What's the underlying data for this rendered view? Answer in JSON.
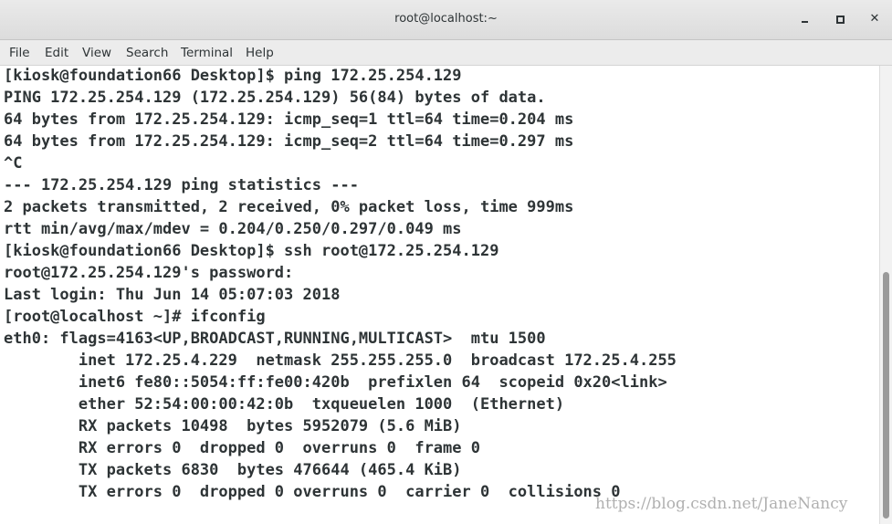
{
  "window": {
    "title": "root@localhost:~",
    "minimize_glyph": "",
    "maximize_glyph": "",
    "close_glyph": "✕"
  },
  "menu": [
    "File",
    "Edit",
    "View",
    "Search",
    "Terminal",
    "Help"
  ],
  "terminal_lines": [
    "[kiosk@foundation66 Desktop]$ ping 172.25.254.129",
    "PING 172.25.254.129 (172.25.254.129) 56(84) bytes of data.",
    "64 bytes from 172.25.254.129: icmp_seq=1 ttl=64 time=0.204 ms",
    "64 bytes from 172.25.254.129: icmp_seq=2 ttl=64 time=0.297 ms",
    "^C",
    "--- 172.25.254.129 ping statistics ---",
    "2 packets transmitted, 2 received, 0% packet loss, time 999ms",
    "rtt min/avg/max/mdev = 0.204/0.250/0.297/0.049 ms",
    "[kiosk@foundation66 Desktop]$ ssh root@172.25.254.129",
    "root@172.25.254.129's password:",
    "Last login: Thu Jun 14 05:07:03 2018",
    "[root@localhost ~]# ifconfig",
    "eth0: flags=4163<UP,BROADCAST,RUNNING,MULTICAST>  mtu 1500",
    "        inet 172.25.4.229  netmask 255.255.255.0  broadcast 172.25.4.255",
    "        inet6 fe80::5054:ff:fe00:420b  prefixlen 64  scopeid 0x20<link>",
    "        ether 52:54:00:00:42:0b  txqueuelen 1000  (Ethernet)",
    "        RX packets 10498  bytes 5952079 (5.6 MiB)",
    "        RX errors 0  dropped 0  overruns 0  frame 0",
    "        TX packets 6830  bytes 476644 (465.4 KiB)",
    "        TX errors 0  dropped 0 overruns 0  carrier 0  collisions 0"
  ],
  "watermark": "https://blog.csdn.net/JaneNancy",
  "colors": {
    "text": "#2e3436",
    "background": "#ffffff",
    "chrome": "#ececec"
  }
}
